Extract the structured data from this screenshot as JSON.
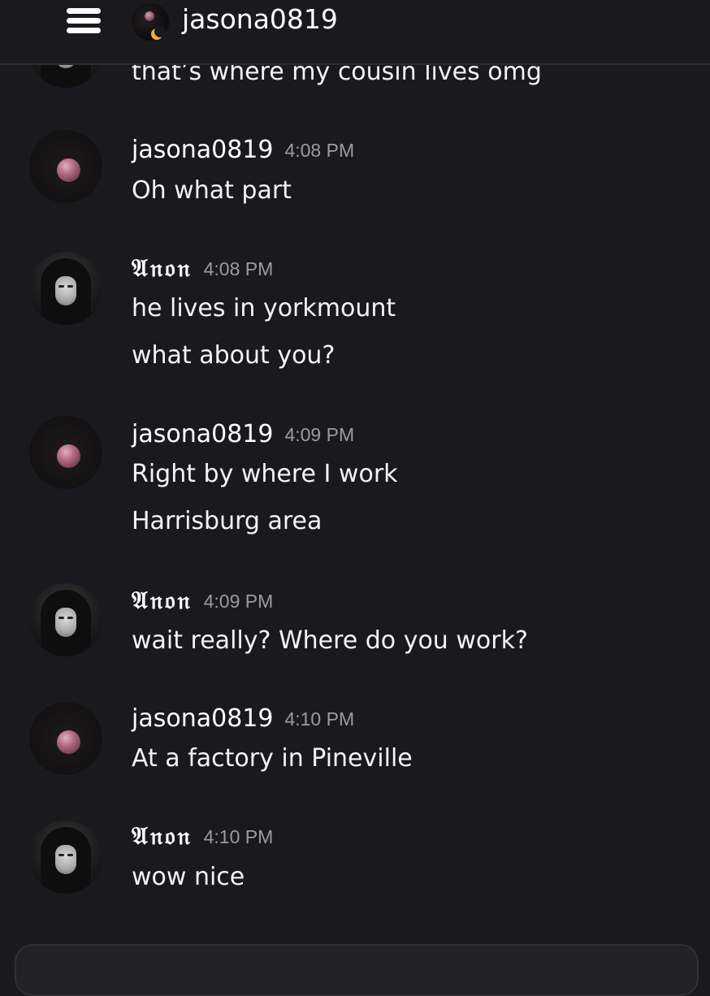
{
  "header": {
    "title": "jasona0819",
    "menu_icon": "hamburger-icon",
    "avatar_icon": "dm-avatar-icon"
  },
  "colors": {
    "background": "#1a1a1e",
    "text": "#f2f3f5",
    "timestamp": "#9a9aa2"
  },
  "partial_message": {
    "text": "that’s where my cousin lives omg"
  },
  "messages": [
    {
      "author": "jasona0819",
      "time": "4:08 PM",
      "lines": [
        "Oh what part"
      ]
    },
    {
      "author": "𝔄𝔫𝔬𝔫",
      "time": "4:08 PM",
      "lines": [
        "he lives in yorkmount",
        "what about you?"
      ]
    },
    {
      "author": "jasona0819",
      "time": "4:09 PM",
      "lines": [
        "Right by where I work",
        "Harrisburg area"
      ]
    },
    {
      "author": "𝔄𝔫𝔬𝔫",
      "time": "4:09 PM",
      "lines": [
        "wait really? Where do you work?"
      ]
    },
    {
      "author": "jasona0819",
      "time": "4:10 PM",
      "lines": [
        "At a factory in Pineville"
      ]
    },
    {
      "author": "𝔄𝔫𝔬𝔫",
      "time": "4:10 PM",
      "lines": [
        "wow nice"
      ]
    }
  ]
}
